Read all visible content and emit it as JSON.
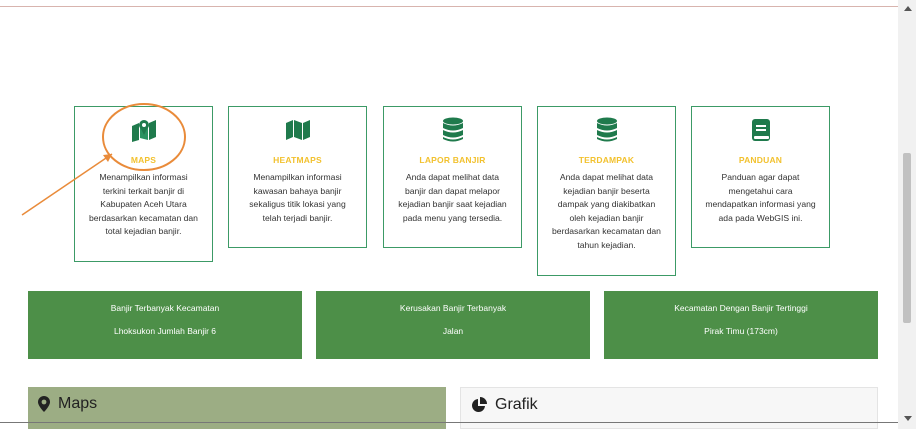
{
  "cards": [
    {
      "title": "MAPS",
      "icon": "map-marker-icon",
      "lines": [
        "Menampilkan informasi",
        "terkini terkait banjir di",
        "Kabupaten Aceh Utara",
        "berdasarkan kecamatan dan",
        "total kejadian banjir."
      ]
    },
    {
      "title": "HEATMAPS",
      "icon": "folded-map-icon",
      "lines": [
        "Menampilkan informasi",
        "kawasan bahaya banjir",
        "sekaligus titik lokasi yang",
        "telah terjadi banjir."
      ]
    },
    {
      "title": "LAPOR BANJIR",
      "icon": "database-icon",
      "lines": [
        "Anda dapat melihat data",
        "banjir dan dapat melapor",
        "kejadian banjir saat kejadian",
        "pada menu yang tersedia."
      ]
    },
    {
      "title": "TERDAMPAK",
      "icon": "database-icon",
      "lines": [
        "Anda dapat melihat data",
        "kejadian banjir beserta",
        "dampak yang diakibatkan",
        "oleh kejadian banjir",
        "berdasarkan kecamatan dan",
        "tahun kejadian."
      ]
    },
    {
      "title": "PANDUAN",
      "icon": "book-icon",
      "lines": [
        "Panduan agar dapat",
        "mengetahui cara",
        "mendapatkan informasi yang",
        "ada pada WebGIS ini."
      ]
    }
  ],
  "stats": [
    {
      "line1": "Banjir Terbanyak Kecamatan",
      "line2": "Lhoksukon Jumlah Banjir 6"
    },
    {
      "line1": "Kerusakan Banjir Terbanyak",
      "line2": "Jalan"
    },
    {
      "line1": "Kecamatan Dengan Banjir Tertinggi",
      "line2": "Pirak Timu (173cm)"
    }
  ],
  "panels": {
    "maps": "Maps",
    "grafik": "Grafik"
  },
  "colors": {
    "accent_green": "#3c9a66",
    "stat_green": "#4d8f48",
    "title_yellow": "#f2c12e",
    "annotation_orange": "#e98b3a"
  }
}
